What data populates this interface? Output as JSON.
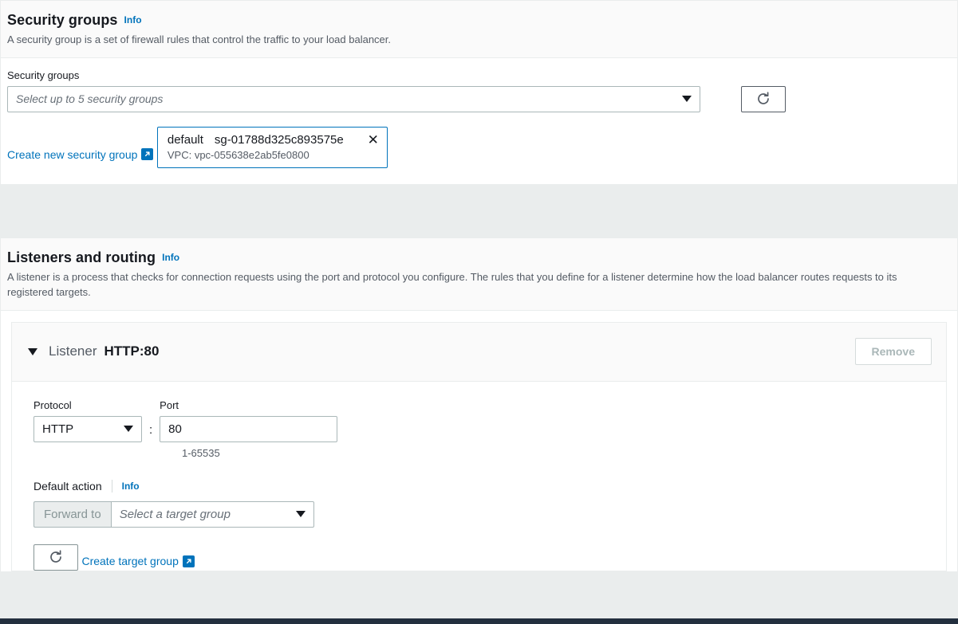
{
  "security_groups_section": {
    "title": "Security groups",
    "info_label": "Info",
    "description": "A security group is a set of firewall rules that control the traffic to your load balancer.",
    "field_label": "Security groups",
    "select_placeholder": "Select up to 5 security groups",
    "dropdown_icon": "caret-down-icon",
    "refresh_icon": "refresh-icon",
    "create_link": "Create new security group",
    "create_link_icon": "external-link-icon",
    "selected_token": {
      "name": "default",
      "id": "sg-01788d325c893575e",
      "vpc": "VPC: vpc-055638e2ab5fe0800",
      "remove_icon": "close-icon"
    }
  },
  "listeners_section": {
    "title": "Listeners and routing",
    "info_label": "Info",
    "description": "A listener is a process that checks for connection requests using the port and protocol you configure. The rules that you define for a listener determine how the load balancer routes requests to its registered targets.",
    "listener": {
      "collapse_icon": "triangle-down-icon",
      "word": "Listener",
      "protocol_port": "HTTP:80",
      "remove_label": "Remove",
      "protocol_label": "Protocol",
      "protocol_value": "HTTP",
      "port_label": "Port",
      "port_value": "80",
      "port_hint": "1-65535",
      "default_action_label": "Default action",
      "default_action_info": "Info",
      "forward_prefix": "Forward to",
      "target_group_placeholder": "Select a target group",
      "refresh_icon": "refresh-icon",
      "create_target_group_link": "Create target group",
      "create_target_group_icon": "external-link-icon"
    }
  },
  "colors": {
    "link": "#0073bb",
    "page_bg": "#eaeded",
    "header_bg": "#fafafa",
    "bottom_bar": "#232f3e",
    "token_border": "#0073bb"
  }
}
